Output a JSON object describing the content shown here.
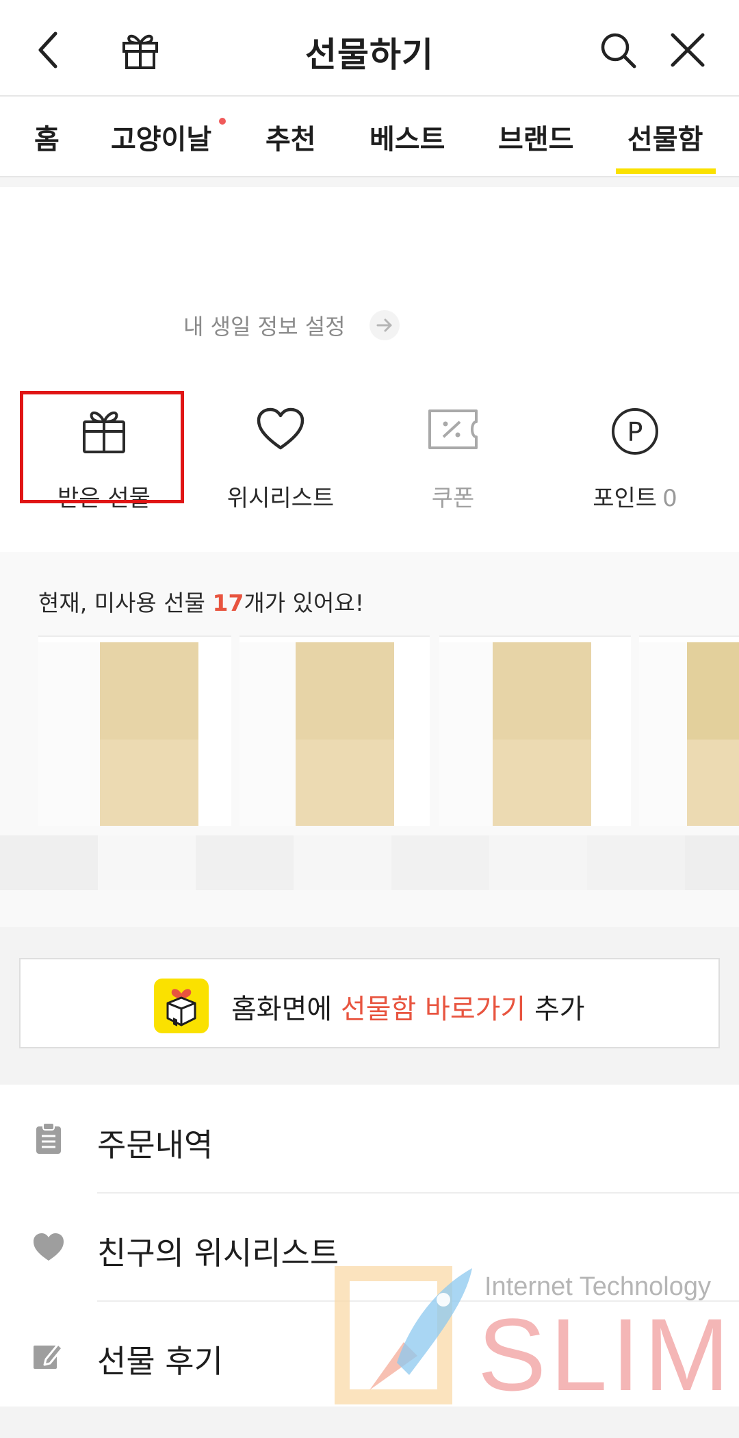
{
  "header": {
    "title": "선물하기",
    "back_icon": "chevron-left-icon",
    "gift_icon": "gift-icon",
    "search_icon": "search-icon",
    "close_icon": "close-icon"
  },
  "tabs": [
    {
      "label": "홈"
    },
    {
      "label": "고양이날",
      "has_dot": true
    },
    {
      "label": "추천"
    },
    {
      "label": "베스트"
    },
    {
      "label": "브랜드"
    },
    {
      "label": "선물함",
      "active": true
    }
  ],
  "birthday": {
    "label": "내 생일 정보 설정"
  },
  "quick_menu": [
    {
      "label": "받은 선물",
      "icon": "gift-icon",
      "highlighted": true
    },
    {
      "label": "위시리스트",
      "icon": "heart-icon"
    },
    {
      "label": "쿠폰",
      "icon": "coupon-icon",
      "muted": true
    },
    {
      "label": "포인트",
      "icon": "point-icon",
      "count": "0"
    }
  ],
  "gifts": {
    "prefix": "현재, 미사용 선물 ",
    "count": "17",
    "suffix": "개가 있어요!"
  },
  "shortcut": {
    "prefix": "홈화면에 ",
    "highlight": "선물함 바로가기",
    "suffix": " 추가",
    "icon": "gift-box-icon"
  },
  "list": [
    {
      "label": "주문내역",
      "icon": "clipboard-icon"
    },
    {
      "label": "친구의 위시리스트",
      "icon": "heart-icon"
    },
    {
      "label": "선물 후기",
      "icon": "edit-icon"
    }
  ],
  "watermark": {
    "tagline": "Internet Technology",
    "brand": "SLIM"
  },
  "colors": {
    "accent_yellow": "#fae100",
    "accent_red": "#e8543f",
    "highlight_box": "#e01515"
  }
}
